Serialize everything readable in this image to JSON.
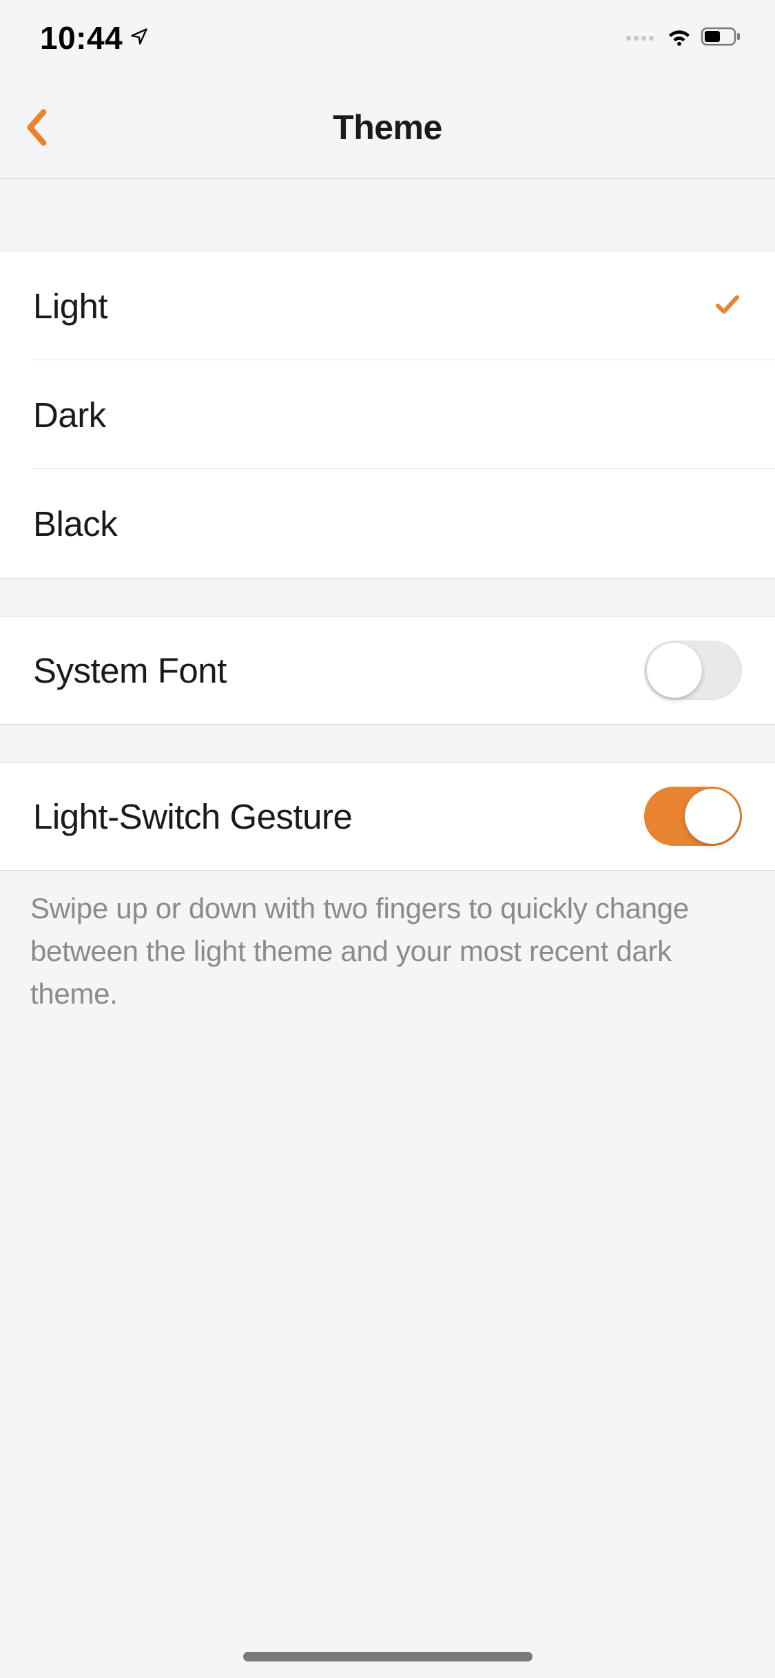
{
  "status": {
    "time": "10:44"
  },
  "nav": {
    "title": "Theme"
  },
  "themes": {
    "items": [
      {
        "label": "Light",
        "selected": true
      },
      {
        "label": "Dark",
        "selected": false
      },
      {
        "label": "Black",
        "selected": false
      }
    ]
  },
  "systemFont": {
    "label": "System Font",
    "enabled": false
  },
  "lightSwitch": {
    "label": "Light-Switch Gesture",
    "enabled": true,
    "description": "Swipe up or down with two fingers to quickly change between the light theme and your most recent dark theme."
  },
  "colors": {
    "accent": "#e88430"
  }
}
